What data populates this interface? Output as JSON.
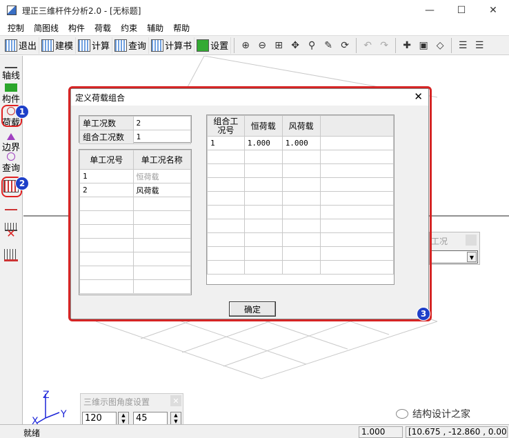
{
  "window": {
    "title": "理正三维杆件分析2.0 - [无标题]"
  },
  "menu": [
    "控制",
    "简图线",
    "构件",
    "荷载",
    "约束",
    "辅助",
    "帮助"
  ],
  "toolbar": {
    "exit": "退出",
    "build": "建模",
    "calc": "计算",
    "query": "查询",
    "book": "计算书",
    "settings": "设置"
  },
  "left_panel": {
    "axis": "轴线",
    "member": "构件",
    "load": "荷载",
    "boundary": "边界",
    "query": "查询"
  },
  "badges": [
    "1",
    "2",
    "3"
  ],
  "dialog": {
    "title": "定义荷载组合",
    "single_count_label": "单工况数",
    "single_count_value": "2",
    "combo_count_label": "组合工况数",
    "combo_count_value": "1",
    "cases_headers": [
      "单工况号",
      "单工况名称"
    ],
    "cases": [
      {
        "no": "1",
        "name": "恒荷载"
      },
      {
        "no": "2",
        "name": "风荷载"
      }
    ],
    "combo_headers": [
      "组合工况号",
      "恒荷载",
      "风荷载"
    ],
    "combos": [
      {
        "no": "1",
        "dead": "1.000",
        "wind": "1.000"
      }
    ],
    "ok_label": "确定"
  },
  "bg_panel": {
    "title": "工况"
  },
  "angle_panel": {
    "title": "三维示图角度设置",
    "value1": "120",
    "value2": "45"
  },
  "axes": {
    "x": "X",
    "y": "Y",
    "z": "Z"
  },
  "status": {
    "ready": "就绪",
    "scale": "1.000",
    "coords": "[10.675 , -12.860 , 0.00"
  },
  "watermark": "结构设计之家",
  "colors": {
    "highlight": "#d52424",
    "badge": "#1e3fc8"
  }
}
